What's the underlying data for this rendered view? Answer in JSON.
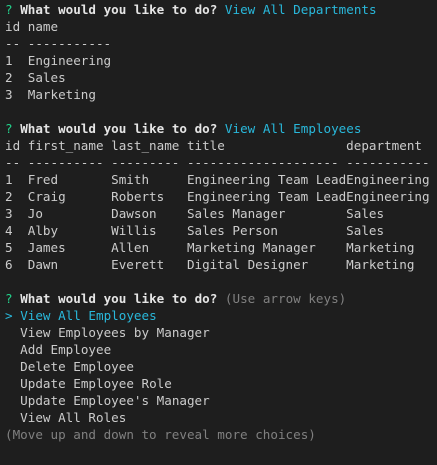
{
  "colors": {
    "background": "#1e1e1e",
    "text": "#cccccc",
    "prompt_mark": "#23d18b",
    "answer": "#29b8db",
    "hint": "#808080"
  },
  "prompt1": {
    "mark": "?",
    "question": "What would you like to do?",
    "answer": "View All Departments"
  },
  "departments_table": {
    "headers": [
      "id",
      "name"
    ],
    "separators": [
      "--",
      "-----------"
    ],
    "rows": [
      [
        "1",
        "Engineering"
      ],
      [
        "2",
        "Sales"
      ],
      [
        "3",
        "Marketing"
      ]
    ]
  },
  "prompt2": {
    "mark": "?",
    "question": "What would you like to do?",
    "answer": "View All Employees"
  },
  "employees_table": {
    "headers": [
      "id",
      "first_name",
      "last_name",
      "title",
      "department"
    ],
    "separators": [
      "--",
      "----------",
      "---------",
      "--------------------",
      "-----------"
    ],
    "rows": [
      [
        "1",
        "Fred",
        "Smith",
        "Engineering Team Lead",
        "Engineering"
      ],
      [
        "2",
        "Craig",
        "Roberts",
        "Engineering Team Lead",
        "Engineering"
      ],
      [
        "3",
        "Jo",
        "Dawson",
        "Sales Manager",
        "Sales"
      ],
      [
        "4",
        "Alby",
        "Willis",
        "Sales Person",
        "Sales"
      ],
      [
        "5",
        "James",
        "Allen",
        "Marketing Manager",
        "Marketing"
      ],
      [
        "6",
        "Dawn",
        "Everett",
        "Digital Designer",
        "Marketing"
      ]
    ]
  },
  "prompt3": {
    "mark": "?",
    "question": "What would you like to do?",
    "hint": "(Use arrow keys)"
  },
  "menu": {
    "pointer": ">",
    "selected_index": 0,
    "items": [
      "View All Employees",
      "View Employees by Manager",
      "Add Employee",
      "Delete Employee",
      "Update Employee Role",
      "Update Employee's Manager",
      "View All Roles"
    ],
    "footer": "(Move up and down to reveal more choices)"
  }
}
